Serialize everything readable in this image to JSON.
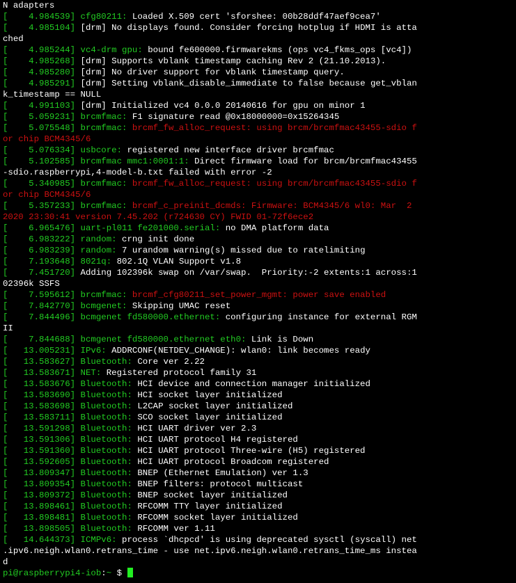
{
  "colors": {
    "background": "#000000",
    "text": "#ffffff",
    "timestamp": "#22cc22",
    "subsystem": "#22cc22",
    "error": "#cc1111",
    "cursor": "#22ee22"
  },
  "log_lines": [
    [
      [
        "w",
        "N adapters"
      ]
    ],
    [
      [
        "g",
        "[    4.984539] cfg80211: "
      ],
      [
        "w",
        "Loaded X.509 cert 'sforshee: 00b28ddf47aef9cea7'"
      ]
    ],
    [
      [
        "g",
        "[    4.985104] "
      ],
      [
        "w",
        "[drm] No displays found. Consider forcing hotplug if HDMI is atta"
      ]
    ],
    [
      [
        "w",
        "ched"
      ]
    ],
    [
      [
        "g",
        "[    4.985244] vc4-drm gpu: "
      ],
      [
        "w",
        "bound fe600000.firmwarekms (ops vc4_fkms_ops [vc4])"
      ]
    ],
    [
      [
        "g",
        "[    4.985268] "
      ],
      [
        "w",
        "[drm] Supports vblank timestamp caching Rev 2 (21.10.2013)."
      ]
    ],
    [
      [
        "g",
        "[    4.985280] "
      ],
      [
        "w",
        "[drm] No driver support for vblank timestamp query."
      ]
    ],
    [
      [
        "g",
        "[    4.985291] "
      ],
      [
        "w",
        "[drm] Setting vblank_disable_immediate to false because get_vblan"
      ]
    ],
    [
      [
        "w",
        "k_timestamp == NULL"
      ]
    ],
    [
      [
        "g",
        "[    4.991103] "
      ],
      [
        "w",
        "[drm] Initialized vc4 0.0.0 20140616 for gpu on minor 1"
      ]
    ],
    [
      [
        "g",
        "[    5.059231] brcmfmac: "
      ],
      [
        "w",
        "F1 signature read @0x18000000=0x15264345"
      ]
    ],
    [
      [
        "g",
        "[    5.075548] brcmfmac: "
      ],
      [
        "r",
        "brcmf_fw_alloc_request: using brcm/brcmfmac43455-sdio f"
      ]
    ],
    [
      [
        "r",
        "or chip BCM4345/6"
      ]
    ],
    [
      [
        "g",
        "[    5.076334] usbcore: "
      ],
      [
        "w",
        "registered new interface driver brcmfmac"
      ]
    ],
    [
      [
        "g",
        "[    5.102585] brcmfmac mmc1:0001:1: "
      ],
      [
        "w",
        "Direct firmware load for brcm/brcmfmac43455"
      ]
    ],
    [
      [
        "w",
        "-sdio.raspberrypi,4-model-b.txt failed with error -2"
      ]
    ],
    [
      [
        "g",
        "[    5.340985] brcmfmac: "
      ],
      [
        "r",
        "brcmf_fw_alloc_request: using brcm/brcmfmac43455-sdio f"
      ]
    ],
    [
      [
        "r",
        "or chip BCM4345/6"
      ]
    ],
    [
      [
        "g",
        "[    5.357233] brcmfmac: "
      ],
      [
        "r",
        "brcmf_c_preinit_dcmds: Firmware: BCM4345/6 wl0: Mar  2"
      ]
    ],
    [
      [
        "r",
        "2020 23:30:41 version 7.45.202 (r724630 CY) FWID 01-72f6ece2"
      ]
    ],
    [
      [
        "g",
        "[    6.965476] uart-pl011 fe201000.serial: "
      ],
      [
        "w",
        "no DMA platform data"
      ]
    ],
    [
      [
        "g",
        "[    6.983222] random: "
      ],
      [
        "w",
        "crng init done"
      ]
    ],
    [
      [
        "g",
        "[    6.983239] random: "
      ],
      [
        "w",
        "7 urandom warning(s) missed due to ratelimiting"
      ]
    ],
    [
      [
        "g",
        "[    7.193648] 8021q: "
      ],
      [
        "w",
        "802.1Q VLAN Support v1.8"
      ]
    ],
    [
      [
        "g",
        "[    7.451720] "
      ],
      [
        "w",
        "Adding 102396k swap on /var/swap.  Priority:-2 extents:1 across:1"
      ]
    ],
    [
      [
        "w",
        "02396k SSFS"
      ]
    ],
    [
      [
        "g",
        "[    7.595612] brcmfmac: "
      ],
      [
        "r",
        "brcmf_cfg80211_set_power_mgmt: power save enabled"
      ]
    ],
    [
      [
        "g",
        "[    7.842770] bcmgenet: "
      ],
      [
        "w",
        "Skipping UMAC reset"
      ]
    ],
    [
      [
        "g",
        "[    7.844496] bcmgenet fd580000.ethernet: "
      ],
      [
        "w",
        "configuring instance for external RGM"
      ]
    ],
    [
      [
        "w",
        "II"
      ]
    ],
    [
      [
        "g",
        "[    7.844688] bcmgenet fd580000.ethernet eth0: "
      ],
      [
        "w",
        "Link is Down"
      ]
    ],
    [
      [
        "g",
        "[   13.005231] IPv6: "
      ],
      [
        "w",
        "ADDRCONF(NETDEV_CHANGE): wlan0: link becomes ready"
      ]
    ],
    [
      [
        "g",
        "[   13.583627] Bluetooth: "
      ],
      [
        "w",
        "Core ver 2.22"
      ]
    ],
    [
      [
        "g",
        "[   13.583671] NET: "
      ],
      [
        "w",
        "Registered protocol family 31"
      ]
    ],
    [
      [
        "g",
        "[   13.583676] Bluetooth: "
      ],
      [
        "w",
        "HCI device and connection manager initialized"
      ]
    ],
    [
      [
        "g",
        "[   13.583690] Bluetooth: "
      ],
      [
        "w",
        "HCI socket layer initialized"
      ]
    ],
    [
      [
        "g",
        "[   13.583698] Bluetooth: "
      ],
      [
        "w",
        "L2CAP socket layer initialized"
      ]
    ],
    [
      [
        "g",
        "[   13.583711] Bluetooth: "
      ],
      [
        "w",
        "SCO socket layer initialized"
      ]
    ],
    [
      [
        "g",
        "[   13.591298] Bluetooth: "
      ],
      [
        "w",
        "HCI UART driver ver 2.3"
      ]
    ],
    [
      [
        "g",
        "[   13.591306] Bluetooth: "
      ],
      [
        "w",
        "HCI UART protocol H4 registered"
      ]
    ],
    [
      [
        "g",
        "[   13.591360] Bluetooth: "
      ],
      [
        "w",
        "HCI UART protocol Three-wire (H5) registered"
      ]
    ],
    [
      [
        "g",
        "[   13.592605] Bluetooth: "
      ],
      [
        "w",
        "HCI UART protocol Broadcom registered"
      ]
    ],
    [
      [
        "g",
        "[   13.809347] Bluetooth: "
      ],
      [
        "w",
        "BNEP (Ethernet Emulation) ver 1.3"
      ]
    ],
    [
      [
        "g",
        "[   13.809354] Bluetooth: "
      ],
      [
        "w",
        "BNEP filters: protocol multicast"
      ]
    ],
    [
      [
        "g",
        "[   13.809372] Bluetooth: "
      ],
      [
        "w",
        "BNEP socket layer initialized"
      ]
    ],
    [
      [
        "g",
        "[   13.898461] Bluetooth: "
      ],
      [
        "w",
        "RFCOMM TTY layer initialized"
      ]
    ],
    [
      [
        "g",
        "[   13.898481] Bluetooth: "
      ],
      [
        "w",
        "RFCOMM socket layer initialized"
      ]
    ],
    [
      [
        "g",
        "[   13.898505] Bluetooth: "
      ],
      [
        "w",
        "RFCOMM ver 1.11"
      ]
    ],
    [
      [
        "g",
        "[   14.644373] ICMPv6: "
      ],
      [
        "w",
        "process `dhcpcd' is using deprecated sysctl (syscall) net"
      ]
    ],
    [
      [
        "w",
        ".ipv6.neigh.wlan0.retrans_time - use net.ipv6.neigh.wlan0.retrans_time_ms instea"
      ]
    ],
    [
      [
        "w",
        "d"
      ]
    ]
  ],
  "prompt": {
    "user_host": "pi@raspberrypi4-iob",
    "separator": ":",
    "path": "~",
    "symbol": " $ ",
    "input": ""
  }
}
